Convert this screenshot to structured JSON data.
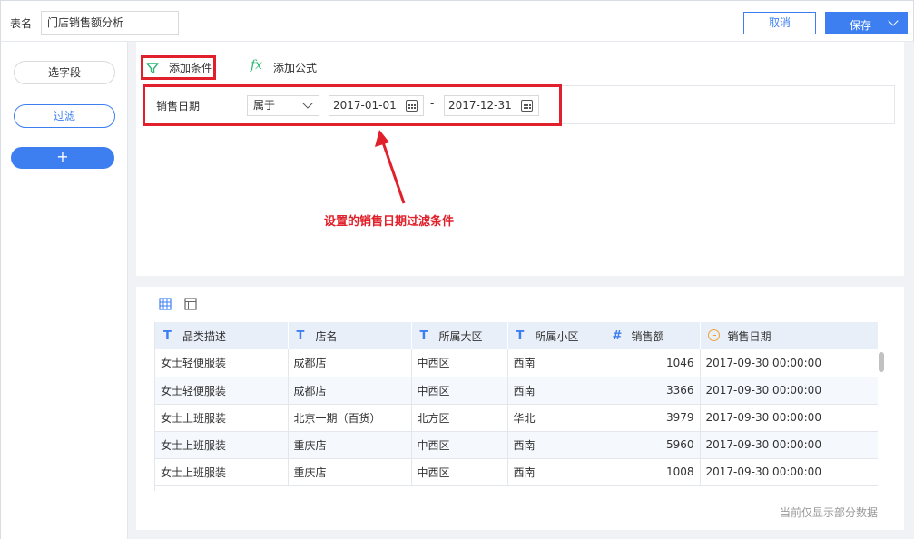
{
  "header": {
    "table_name_label": "表名",
    "table_name_value": "门店销售额分析",
    "cancel_label": "取消",
    "save_label": "保存"
  },
  "steps": {
    "select_fields": "选字段",
    "filter": "过滤",
    "add": "+"
  },
  "toolbar": {
    "add_condition": "添加条件",
    "add_formula": "添加公式",
    "formula_glyph": "fx"
  },
  "condition": {
    "field": "销售日期",
    "operator": "属于",
    "start_date": "2017-01-01",
    "separator": "-",
    "end_date": "2017-12-31"
  },
  "annotation": "设置的销售日期过滤条件",
  "table": {
    "columns": [
      {
        "label": "品类描述",
        "type": "T"
      },
      {
        "label": "店名",
        "type": "T"
      },
      {
        "label": "所属大区",
        "type": "T"
      },
      {
        "label": "所属小区",
        "type": "T"
      },
      {
        "label": "销售额",
        "type": "#"
      },
      {
        "label": "销售日期",
        "type": "date"
      }
    ],
    "rows": [
      [
        "女士轻便服装",
        "成都店",
        "中西区",
        "西南",
        "1046",
        "2017-09-30 00:00:00"
      ],
      [
        "女士轻便服装",
        "成都店",
        "中西区",
        "西南",
        "3366",
        "2017-09-30 00:00:00"
      ],
      [
        "女士上班服装",
        "北京一期（百货）",
        "北方区",
        "华北",
        "3979",
        "2017-09-30 00:00:00"
      ],
      [
        "女士上班服装",
        "重庆店",
        "中西区",
        "西南",
        "5960",
        "2017-09-30 00:00:00"
      ],
      [
        "女士上班服装",
        "重庆店",
        "中西区",
        "西南",
        "1008",
        "2017-09-30 00:00:00"
      ]
    ]
  },
  "footer_note": "当前仅显示部分数据",
  "colors": {
    "accent": "#3d7ff0",
    "highlight": "#e0202a",
    "formula": "#2bb673",
    "date_icon": "#f0a030"
  }
}
